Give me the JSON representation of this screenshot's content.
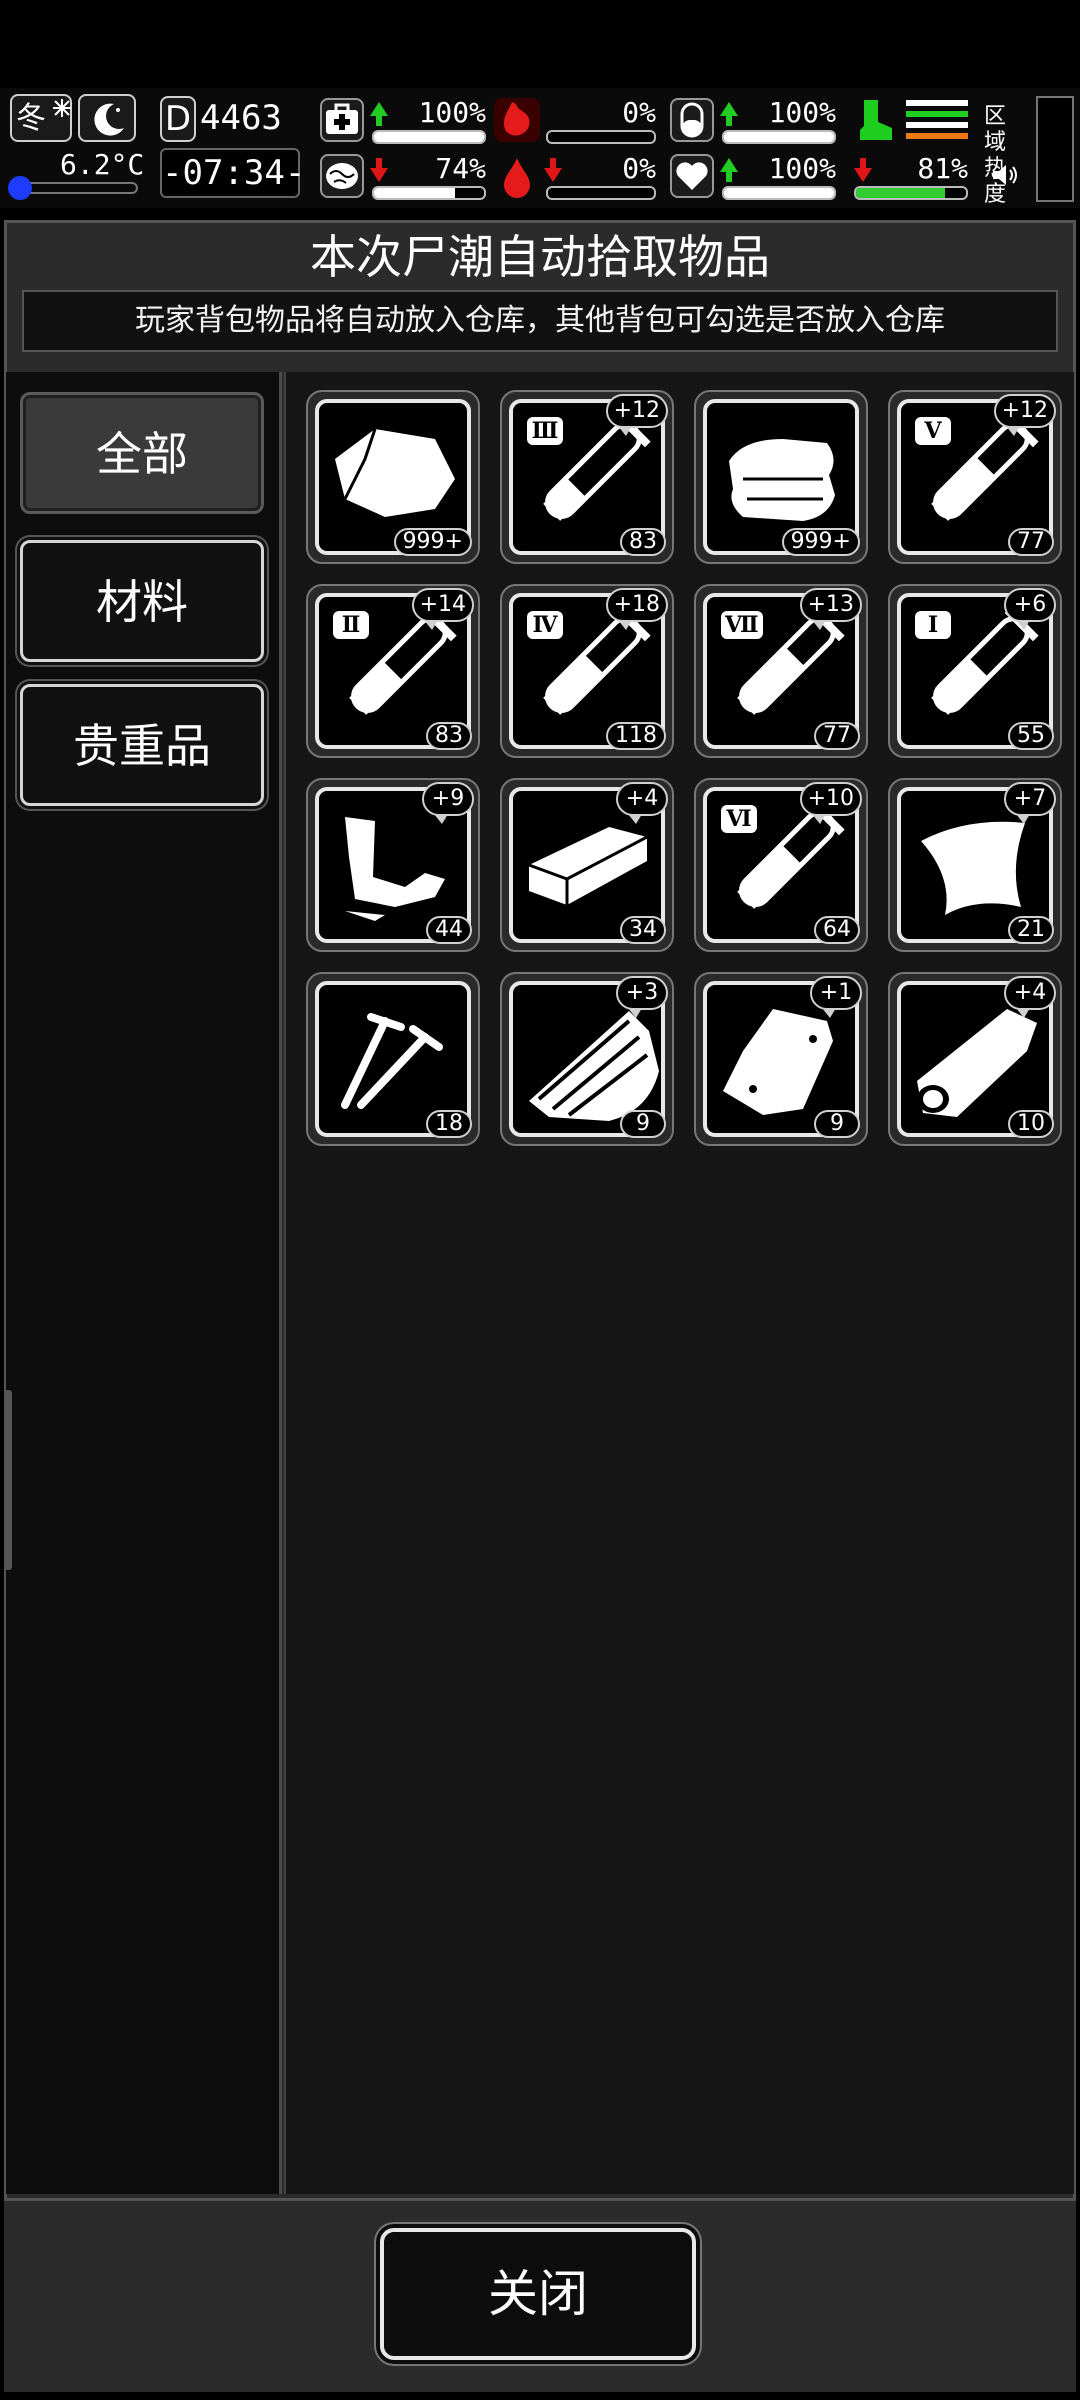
{
  "hud": {
    "season": "冬",
    "weather_icon": "snow-icon",
    "time_of_day_icon": "moon-icon",
    "temperature": "6.2°C",
    "day_marker": "D",
    "day_count": "4463",
    "clock": "-07:34-",
    "stats": [
      {
        "name": "health",
        "icon": "medkit-icon",
        "trend": "up",
        "value": "100%",
        "level": 1.0
      },
      {
        "name": "hunger",
        "icon": "stomach-icon",
        "trend": "none",
        "value": "0%",
        "level": 0.0
      },
      {
        "name": "medicine",
        "icon": "pill-icon",
        "trend": "up",
        "value": "100%",
        "level": 1.0
      },
      {
        "name": "sanity",
        "icon": "brain-icon",
        "trend": "down",
        "value": "74%",
        "level": 0.74
      },
      {
        "name": "thirst",
        "icon": "blood-drop-icon",
        "trend": "down",
        "value": "0%",
        "level": 0.0
      },
      {
        "name": "heart",
        "icon": "heart-icon",
        "trend": "up",
        "value": "100%",
        "level": 1.0
      }
    ],
    "stamina": {
      "icon": "boot-icon",
      "trend": "down",
      "value": "81%",
      "level": 0.81
    },
    "zone_heat_label_1": "区域",
    "zone_heat_label_2": "热度",
    "sound_icon": "speaker-icon"
  },
  "dialog": {
    "title": "本次尸潮自动拾取物品",
    "subtitle": "玩家背包物品将自动放入仓库，其他背包可勾选是否放入仓库",
    "categories": [
      {
        "label": "全部",
        "active": true
      },
      {
        "label": "材料",
        "active": false
      },
      {
        "label": "贵重品",
        "active": false
      }
    ],
    "items": [
      {
        "icon": "meat-icon",
        "count": "999+",
        "plus": ""
      },
      {
        "icon": "test-tube-3-icon",
        "tier": "Ⅲ",
        "count": "83",
        "plus": "+12"
      },
      {
        "icon": "cloth-icon",
        "count": "999+",
        "plus": ""
      },
      {
        "icon": "test-tube-5-icon",
        "tier": "Ⅴ",
        "count": "77",
        "plus": "+12"
      },
      {
        "icon": "test-tube-2-icon",
        "tier": "Ⅱ",
        "count": "83",
        "plus": "+14"
      },
      {
        "icon": "test-tube-4-icon",
        "tier": "Ⅳ",
        "count": "118",
        "plus": "+18"
      },
      {
        "icon": "test-tube-7-icon",
        "tier": "Ⅶ",
        "count": "77",
        "plus": "+13"
      },
      {
        "icon": "test-tube-1-icon",
        "tier": "Ⅰ",
        "count": "55",
        "plus": "+6"
      },
      {
        "icon": "scrap-metal-icon",
        "count": "44",
        "plus": "+9"
      },
      {
        "icon": "brick-icon",
        "count": "34",
        "plus": "+4"
      },
      {
        "icon": "test-tube-6-icon",
        "tier": "Ⅵ",
        "count": "64",
        "plus": "+10"
      },
      {
        "icon": "leather-icon",
        "count": "21",
        "plus": "+7"
      },
      {
        "icon": "nails-icon",
        "count": "18",
        "plus": ""
      },
      {
        "icon": "wood-planks-icon",
        "count": "9",
        "plus": "+3"
      },
      {
        "icon": "metal-plate-icon",
        "count": "9",
        "plus": "+1"
      },
      {
        "icon": "log-icon",
        "count": "10",
        "plus": "+4"
      }
    ],
    "close_label": "关闭"
  }
}
